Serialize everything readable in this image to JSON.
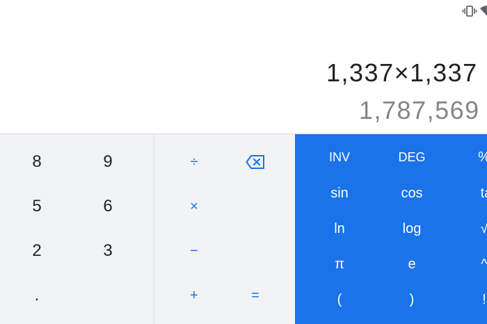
{
  "display": {
    "formula": "1,337×1,337",
    "result": "1,787,569"
  },
  "numpad": {
    "rows": [
      [
        "8",
        "9"
      ],
      [
        "5",
        "6"
      ],
      [
        "2",
        "3"
      ],
      [
        "."
      ]
    ]
  },
  "operators": {
    "divide": "÷",
    "multiply": "×",
    "minus": "−",
    "plus": "+",
    "equals": "=",
    "backspace_icon": "backspace-icon"
  },
  "advanced": {
    "rows": [
      [
        "INV",
        "DEG",
        "%"
      ],
      [
        "sin",
        "cos",
        "ta"
      ],
      [
        "ln",
        "log",
        "√"
      ],
      [
        "π",
        "e",
        "^"
      ],
      [
        "(",
        ")",
        "!"
      ]
    ]
  },
  "status_bar": {
    "icons": [
      "vibrate-icon",
      "wifi-icon"
    ]
  },
  "colors": {
    "accent": "#1a73e8",
    "keypad_bg": "#f1f3f4",
    "result_text": "#80868b",
    "formula_text": "#202124"
  }
}
